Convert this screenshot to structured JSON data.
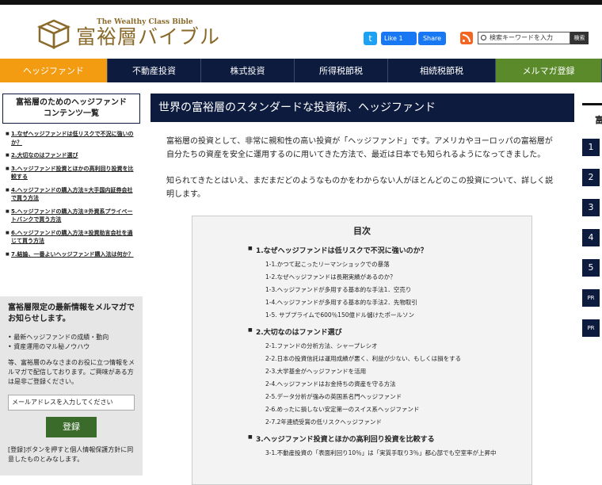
{
  "header": {
    "logo_en": "The Wealthy Class Bible",
    "logo_jp": "富裕層バイブル",
    "twitter_icon": "t",
    "fb_like": "Like 1",
    "fb_share": "Share",
    "search_placeholder": "検索キーワードを入力",
    "search_button": "検索"
  },
  "nav": [
    {
      "label": "ヘッジファンド",
      "width": 136,
      "style": "active"
    },
    {
      "label": "不動産投資",
      "width": 118,
      "style": ""
    },
    {
      "label": "株式投資",
      "width": 118,
      "style": ""
    },
    {
      "label": "所得税節税",
      "width": 118,
      "style": ""
    },
    {
      "label": "相続税節税",
      "width": 136,
      "style": ""
    },
    {
      "label": "メルマガ登録",
      "width": 134,
      "style": "green"
    }
  ],
  "sidebar": {
    "title_line1": "富裕層のためのヘッジファンド",
    "title_line2": "コンテンツ一覧",
    "items": [
      "1.なぜヘッジファンドは低リスクで不況に強いのか？",
      "2.大切なのはファンド選び",
      "3.ヘッジファンド投資とほかの高利回り投資を比較する",
      "4.ヘッジファンドの購入方法①大手国内証券会社で買う方法",
      "5.ヘッジファンドの購入方法②外資系プライベートバンクで買う方法",
      "6.ヘッジファンドの購入方法③投資助言会社を通じて買う方法",
      "7.結論、一番よいヘッジファンド購入法は何か？"
    ]
  },
  "mail": {
    "title_line1": "富裕層限定の最新情報をメルマガで",
    "title_line2": "お知らせします。",
    "bullet1": "最新ヘッジファンドの成績・動向",
    "bullet2": "資産運用のマル秘ノウハウ",
    "text": "等、富裕層のみなさまのお役に立つ情報をメルマガで配信しております。ご興味がある方は是非ご登録ください。",
    "input_placeholder": "メールアドレスを入力してください",
    "button": "登録",
    "footer": "[登録]ボタンを押すと個人情報保護方針に同意したものとみなします。"
  },
  "main": {
    "title": "世界の富裕層のスタンダードな投資術、ヘッジファンド",
    "para1": "富裕層の投資として、非常に親和性の高い投資が「ヘッジファンド」です。アメリカやヨーロッパの富裕層が自分たちの資産を安全に運用するのに用いてきた方法で、最近は日本でも知られるようになってきました。",
    "para2": "知られてきたとはいえ、まだまだどのようなものかをわからない人がほとんどのこの投資について、詳しく説明します。",
    "toc_title": "目次",
    "toc": [
      {
        "sec": "1.なぜヘッジファンドは低リスクで不況に強いのか？",
        "subs": [
          "1-1.かつて起こったリーマンショックでの暴落",
          "1-2.なぜヘッジファンドは長期実績があるのか？",
          "1-3.ヘッジファンドが多用する基本的な手法1．空売り",
          "1-4.ヘッジファンドが多用する基本的な手法2．先物取引",
          "1-5. サブプライムで600％150億ドル儲けたポールソン"
        ]
      },
      {
        "sec": "2.大切なのはファンド選び",
        "subs": [
          "2-1.ファンドの分析方法、シャープレシオ",
          "2-2.日本の投資信託は運用成績が悪く、利益が少ない、もしくは損をする",
          "2-3.大学基金がヘッジファンドを活用",
          "2-4.ヘッジファンドはお金持ちの資産を守る方法",
          "2-5.データ分析が強みの英国系名門ヘッジファンド",
          "2-6.めったに損しない安定第一のスイス系ヘッジファンド",
          "2-7.2年連続受賞の低リスクヘッジファンド"
        ]
      },
      {
        "sec": "3.ヘッジファンド投資とほかの高利回り投資を比較する",
        "subs": [
          "3-1.不動産投資の「表面利回り10％」は「実質手取り3％」都心部でも空室率が上昇中"
        ]
      }
    ]
  },
  "right": {
    "head": "富",
    "items": [
      "1",
      "2",
      "3",
      "4",
      "5",
      "PR",
      "PR"
    ]
  }
}
